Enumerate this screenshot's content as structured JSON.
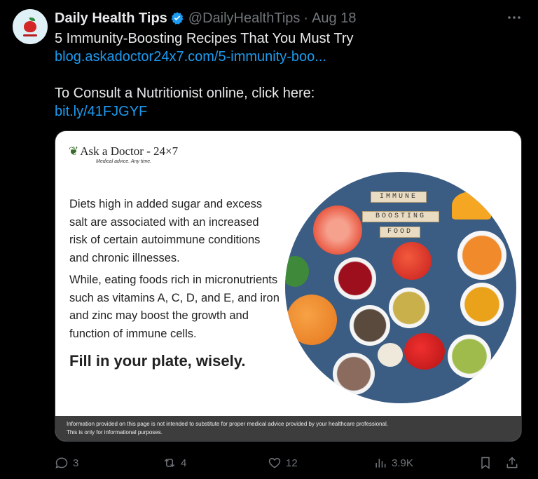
{
  "tweet": {
    "author_name": "Daily Health Tips",
    "handle": "@DailyHealthTips",
    "separator": "·",
    "date": "Aug 18",
    "title_line": "5 Immunity-Boosting Recipes That You Must Try",
    "link1": "blog.askadoctor24x7.com/5-immunity-boo...",
    "consult_line": "To Consult a Nutritionist online, click here:",
    "link2": "bit.ly/41FJGYF"
  },
  "card": {
    "brand": "Ask a Doctor - 24×7",
    "brand_tagline": "Medical advice. Any time.",
    "paragraph1": "Diets high in added sugar and excess salt are associated with an increased risk of certain autoimmune conditions and chronic illnesses.",
    "paragraph2": "While, eating foods rich in micronutrients such as vitamins A, C, D, and E, and iron and zinc may boost the growth and function of immune cells.",
    "slogan": "Fill in your plate, wisely.",
    "tiles": [
      "IMMUNE",
      "BOOSTING",
      "FOOD"
    ],
    "disclaimer_line1": "Information provided on this page is not intended to substitute for proper medical advice provided by your healthcare professional.",
    "disclaimer_line2": "This is only for informational purposes."
  },
  "actions": {
    "replies": "3",
    "reposts": "4",
    "likes": "12",
    "views": "3.9K"
  },
  "colors": {
    "background": "#000000",
    "text": "#e7e9ea",
    "muted": "#71767b",
    "link": "#1d9bf0",
    "verified": "#1d9bf0"
  }
}
